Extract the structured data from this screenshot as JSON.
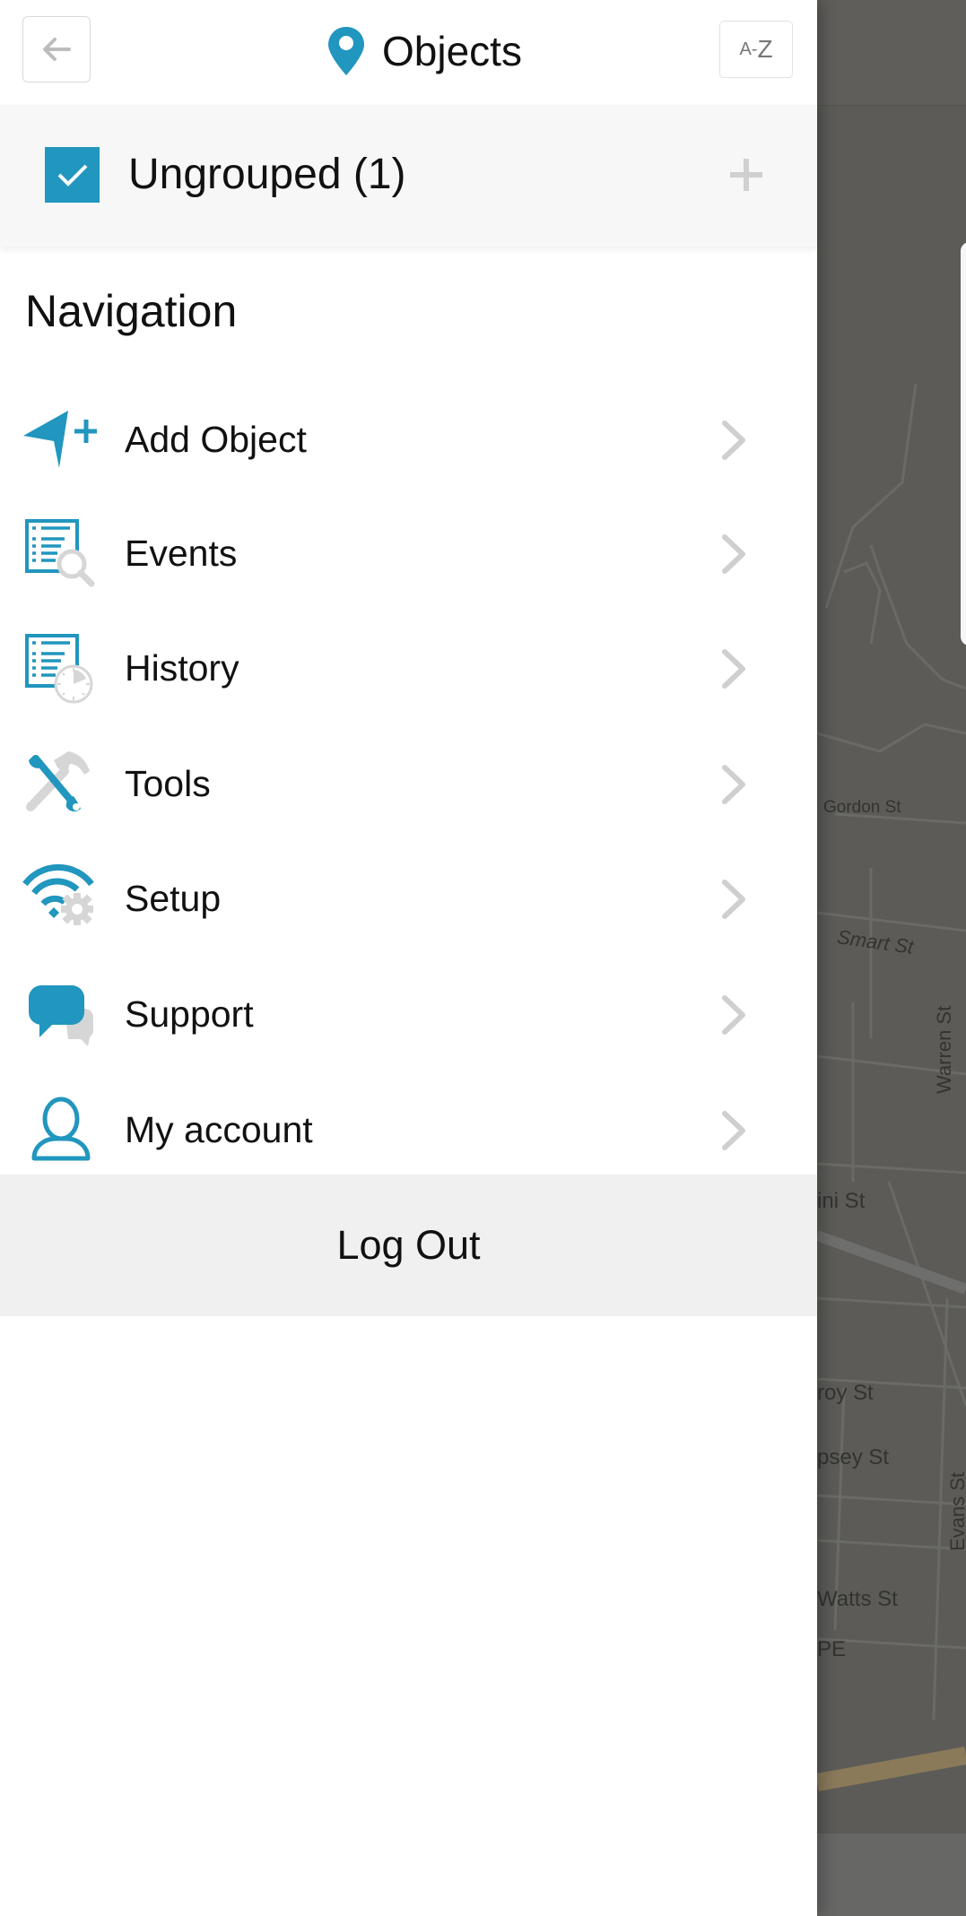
{
  "header": {
    "title": "Objects",
    "back_icon": "arrow-left-icon",
    "title_icon": "map-pin-icon",
    "sort_button": {
      "a": "A",
      "dash": "-",
      "z": "Z"
    }
  },
  "groups": [
    {
      "label": "Ungrouped (1)",
      "checked": true,
      "action_icon": "plus-icon"
    }
  ],
  "navigation": {
    "heading": "Navigation",
    "items": [
      {
        "label": "Add Object",
        "icon": "add-object-icon"
      },
      {
        "label": "Events",
        "icon": "events-icon"
      },
      {
        "label": "History",
        "icon": "history-icon"
      },
      {
        "label": "Tools",
        "icon": "tools-icon"
      },
      {
        "label": "Setup",
        "icon": "setup-icon"
      },
      {
        "label": "Support",
        "icon": "support-icon"
      },
      {
        "label": "My account",
        "icon": "account-icon"
      }
    ]
  },
  "logout_label": "Log Out",
  "background_map": {
    "notification_icon": "bell-icon",
    "street_labels": [
      "Gordon St",
      "Smart St",
      "Warren St",
      "ini St",
      "roy St",
      "psey St",
      "Evans St",
      "Watts St",
      "PE"
    ]
  },
  "colors": {
    "accent": "#2196be",
    "secondary_icon": "#d6d6d6",
    "overlay_map": "#5c5b57"
  }
}
